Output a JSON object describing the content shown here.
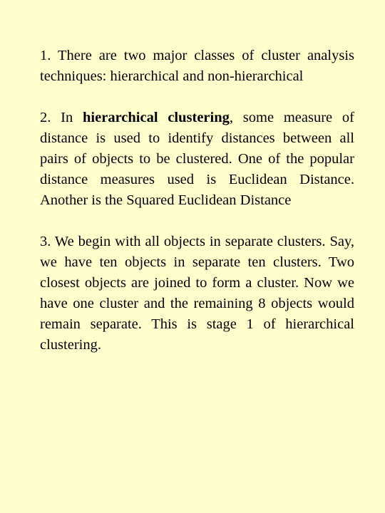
{
  "slide": {
    "background_color": "#FFFFCC",
    "text_color": "#000000",
    "paragraphs": [
      {
        "text": "1. There are two major classes of cluster analysis techniques: hierarchical and non-hierarchical"
      },
      {
        "prefix": "2. In ",
        "bold": "hierarchical clustering",
        "suffix": ", some measure of distance is used to identify distances between all pairs of objects to be clustered. One of the popular distance measures used is Euclidean Distance. Another is the Squared Euclidean Distance"
      },
      {
        "text": "3. We begin with all objects in separate clusters. Say, we have ten objects in separate ten clusters. Two closest objects are joined to form a cluster. Now we have one cluster and the remaining 8 objects would remain separate. This is stage 1 of hierarchical clustering."
      }
    ]
  }
}
